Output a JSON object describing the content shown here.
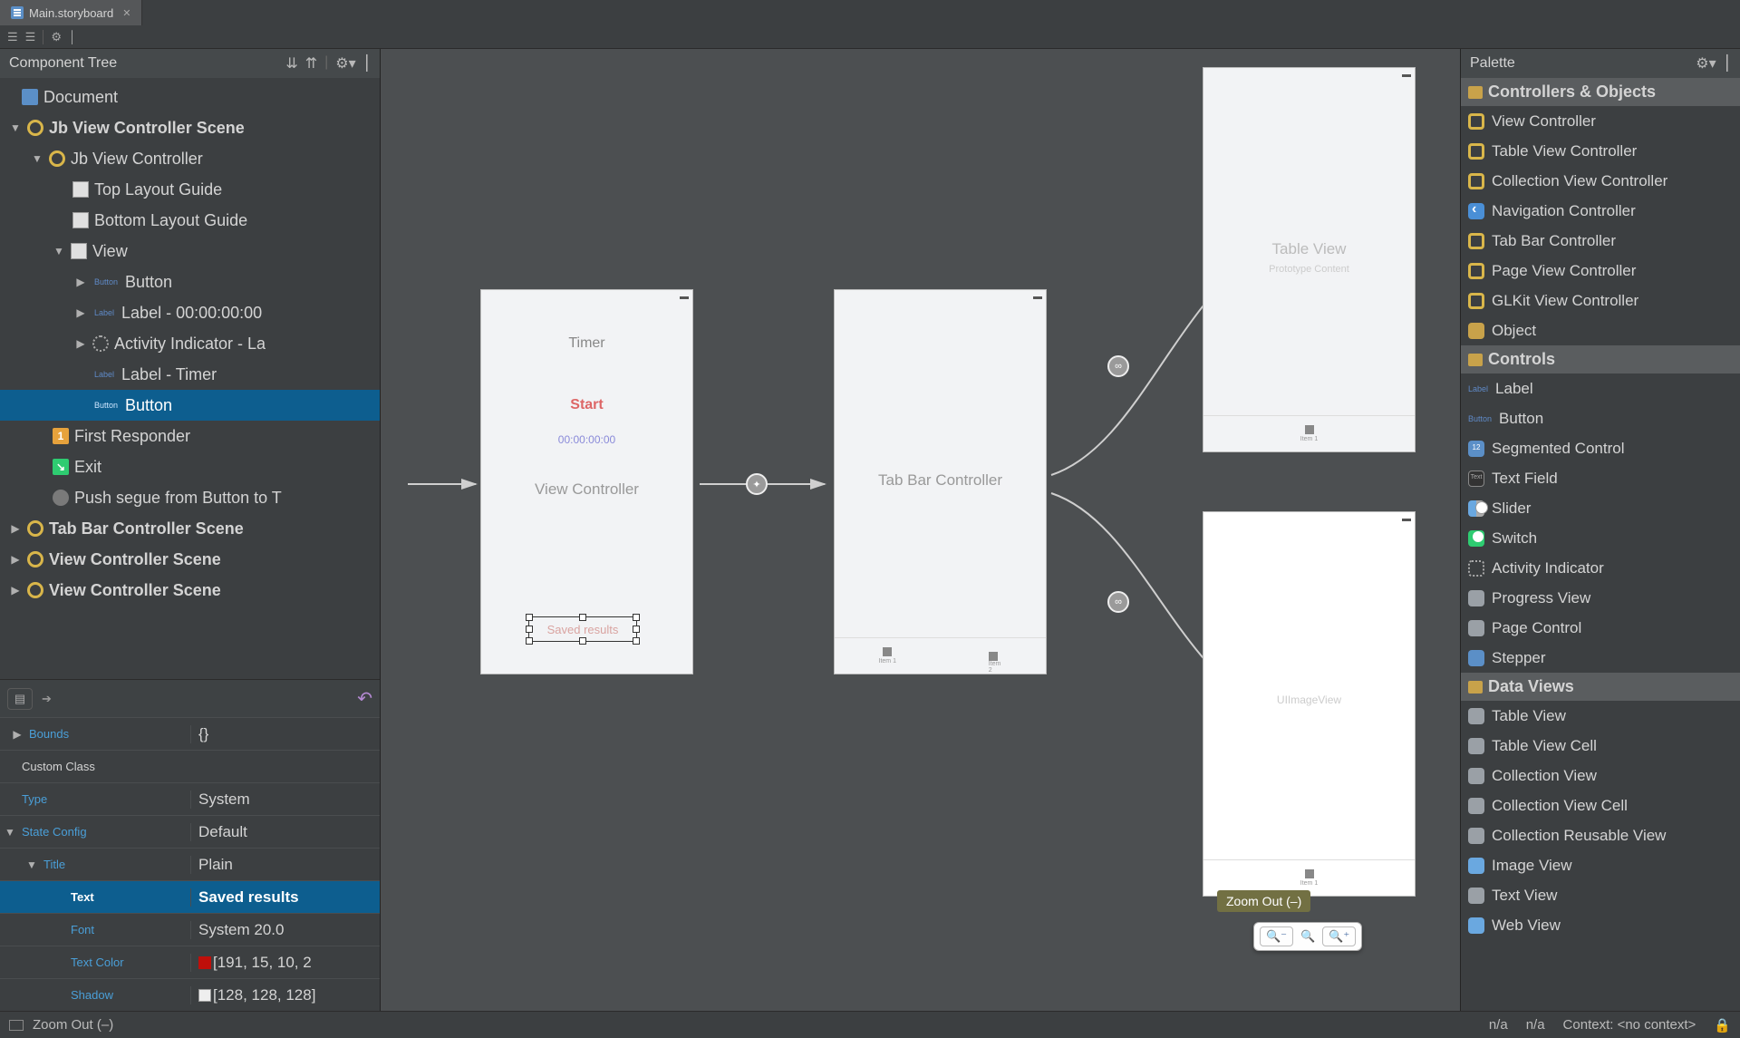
{
  "tab": {
    "filename": "Main.storyboard"
  },
  "tree_header": "Component Tree",
  "tree": {
    "doc": "Document",
    "scene1": "Jb View Controller Scene",
    "vc": "Jb View Controller",
    "top_guide": "Top Layout Guide",
    "bottom_guide": "Bottom Layout Guide",
    "view": "View",
    "btn1": "Button",
    "lbl1": "Label - 00:00:00:00",
    "act1": "Activity Indicator - La",
    "lbl_timer": "Label - Timer",
    "btn2": "Button",
    "first_responder": "First Responder",
    "exit": "Exit",
    "segue": "Push segue from Button to T",
    "scene_tab": "Tab Bar Controller Scene",
    "scene_v1": "View Controller Scene",
    "scene_v2": "View Controller Scene"
  },
  "props": {
    "bounds_l": "Bounds",
    "bounds_v": "{}",
    "class_l": "Custom Class",
    "class_v": "",
    "type_l": "Type",
    "type_v": "System",
    "state_l": "State Config",
    "state_v": "Default",
    "title_l": "Title",
    "title_v": "Plain",
    "text_l": "Text",
    "text_v": "Saved results",
    "font_l": "Font",
    "font_v": "System 20.0",
    "tcolor_l": "Text Color",
    "tcolor_v": "[191, 15, 10, 2",
    "shadow_l": "Shadow",
    "shadow_v": "[128, 128, 128]"
  },
  "canvas": {
    "timer_title": "Timer",
    "start": "Start",
    "time": "00:00:00:00",
    "vc_label": "View Controller",
    "saved_results": "Saved results",
    "tabbar_label": "Tab Bar Controller",
    "tableview": "Table View",
    "proto": "Prototype Content",
    "uiimg": "UIImageView",
    "item1": "Item 1",
    "item2": "Item 2",
    "zoom_tip": "Zoom Out (–)"
  },
  "palette": {
    "header": "Palette",
    "sec1": "Controllers & Objects",
    "sec1_items": [
      "View Controller",
      "Table View Controller",
      "Collection View Controller",
      "Navigation Controller",
      "Tab Bar Controller",
      "Page View Controller",
      "GLKit View Controller",
      "Object"
    ],
    "sec2": "Controls",
    "sec2_items": [
      "Label",
      "Button",
      "Segmented Control",
      "Text Field",
      "Slider",
      "Switch",
      "Activity Indicator",
      "Progress View",
      "Page Control",
      "Stepper"
    ],
    "sec3": "Data Views",
    "sec3_items": [
      "Table View",
      "Table View Cell",
      "Collection View",
      "Collection View Cell",
      "Collection Reusable View",
      "Image View",
      "Text View",
      "Web View"
    ]
  },
  "status": {
    "left": "Zoom Out (–)",
    "r1": "n/a",
    "r2": "n/a",
    "ctx": "Context: <no context>"
  },
  "colors": {
    "text_color": "#bf0f0a",
    "shadow_color": "#808080"
  }
}
